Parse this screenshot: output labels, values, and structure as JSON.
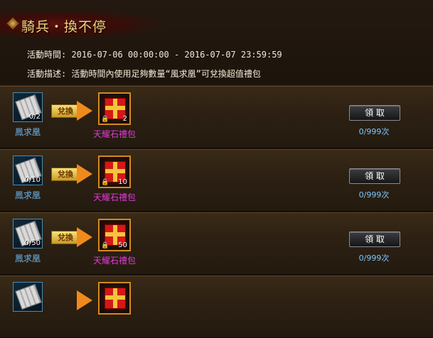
{
  "event": {
    "title": "騎兵・換不停",
    "time_line": "活動時間: 2016-07-06 00:00:00  -  2016-07-07 23:59:59",
    "desc_line": "活動描述: 活動時間內使用足夠數量“風求凰”可兌換超值禮包"
  },
  "exchange_label": "兌換",
  "rows": [
    {
      "req_name": "鳳求凰",
      "req_count": "0/2",
      "reward_name": "天耀石禮包",
      "reward_count": "2",
      "button": "領 取",
      "limit": "0/999次"
    },
    {
      "req_name": "鳳求凰",
      "req_count": "0/10",
      "reward_name": "天耀石禮包",
      "reward_count": "10",
      "button": "領 取",
      "limit": "0/999次"
    },
    {
      "req_name": "鳳求凰",
      "req_count": "0/50",
      "reward_name": "天耀石禮包",
      "reward_count": "50",
      "button": "領 取",
      "limit": "0/999次"
    },
    {
      "req_name": "",
      "req_count": "",
      "reward_name": "",
      "reward_count": "",
      "button": "",
      "limit": ""
    }
  ],
  "colors": {
    "title": "#f3d47a",
    "req_name": "#6cb5ec",
    "reward_name": "#e23ad8",
    "limit": "#7cc9ff"
  }
}
